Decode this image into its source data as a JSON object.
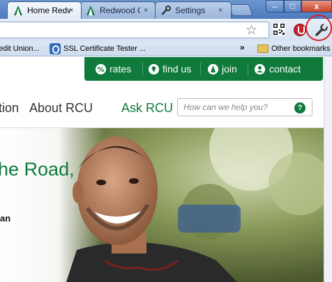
{
  "browser": {
    "tabs": [
      {
        "title": "Home Redw",
        "close": "×",
        "active": true
      },
      {
        "title": "Redwood Cr",
        "close": "×",
        "active": false
      },
      {
        "title": "Settings",
        "close": "×",
        "active": false
      }
    ],
    "window_buttons": {
      "minimize": "–",
      "maximize": "□",
      "close": "x"
    },
    "toolbar_icons": [
      "star-icon",
      "qr-code-icon",
      "stop-icon",
      "wrench-icon"
    ],
    "highlight_color": "#d81f1f"
  },
  "bookmarks_bar": {
    "items": [
      {
        "label": "edit Union..."
      },
      {
        "label": "SSL Certificate Tester ..."
      }
    ],
    "overflow": "»",
    "other": "Other bookmarks"
  },
  "site": {
    "brand_color": "#0f7a3b",
    "utility_nav": [
      {
        "label": "rates",
        "icon": "percent-icon"
      },
      {
        "label": "find us",
        "icon": "location-pin-icon"
      },
      {
        "label": "join",
        "icon": "join-icon"
      },
      {
        "label": "contact",
        "icon": "person-icon"
      }
    ],
    "main_nav": [
      {
        "label": "tion"
      },
      {
        "label": "About RCU"
      }
    ],
    "ask": {
      "label": "Ask RCU",
      "placeholder": "How can we help you?",
      "help": "?"
    },
    "hero": {
      "headline": "he Road,",
      "subline": "an"
    }
  }
}
